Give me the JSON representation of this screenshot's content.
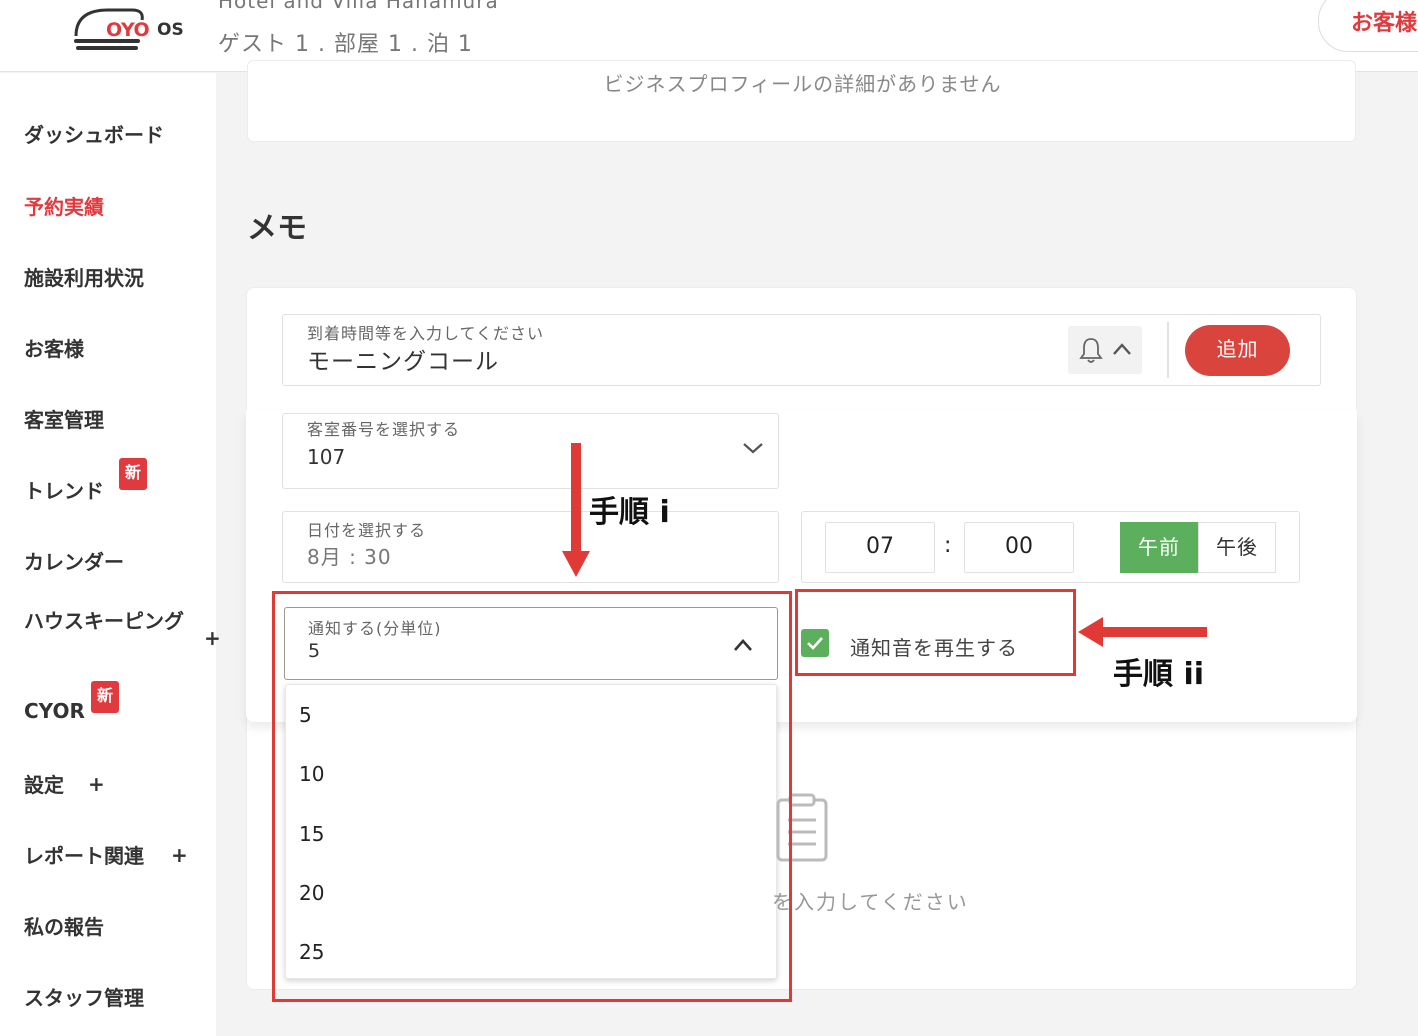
{
  "header": {
    "logo_brand": "OYO",
    "logo_suffix": "OS",
    "hotel_name": "Hotel and Villa Hanamura",
    "sub": "ゲスト 1 . 部屋 1 . 泊 1",
    "guest_button": "お客様"
  },
  "sidebar": {
    "items": [
      {
        "label": "ダッシュボード"
      },
      {
        "label": "予約実績",
        "active": true
      },
      {
        "label": "施設利用状況"
      },
      {
        "label": "お客様"
      },
      {
        "label": "客室管理"
      },
      {
        "label": "トレンド",
        "badge": "新"
      },
      {
        "label": "カレンダー"
      },
      {
        "label": "ハウスキーピング"
      },
      {
        "label": "CYOR",
        "badge": "新"
      },
      {
        "label": "設定"
      },
      {
        "label": "レポート関連"
      },
      {
        "label": "私の報告"
      },
      {
        "label": "スタッフ管理"
      }
    ],
    "badge_new": "新",
    "expand_symbol": "+"
  },
  "business_profile": {
    "empty_text": "ビジネスプロフィールの詳細がありません"
  },
  "memo": {
    "title": "メモ",
    "input_placeholder": "到着時間等を入力してください",
    "input_value": "モーニングコール",
    "add_button": "追加",
    "room_label": "客室番号を選択する",
    "room_value": "107",
    "date_label": "日付を選択する",
    "date_value": "8月 : 30",
    "time_hour": "07",
    "time_separator": ":",
    "time_minute": "00",
    "am_label": "午前",
    "pm_label": "午後",
    "notify_label": "通知する(分単位)",
    "notify_value": "5",
    "notify_options": [
      "5",
      "10",
      "15",
      "20",
      "25"
    ],
    "sound_label": "通知音を再生する",
    "sound_checked": true,
    "empty_text": "を入力してください"
  },
  "annotations": {
    "step1": "手順 i",
    "step2": "手順 ii",
    "color": "#e03a36"
  },
  "colors": {
    "brand": "#e03a3e",
    "add_button": "#d9453d",
    "am_selected": "#5cb05d",
    "checkbox": "#5cb05d"
  }
}
